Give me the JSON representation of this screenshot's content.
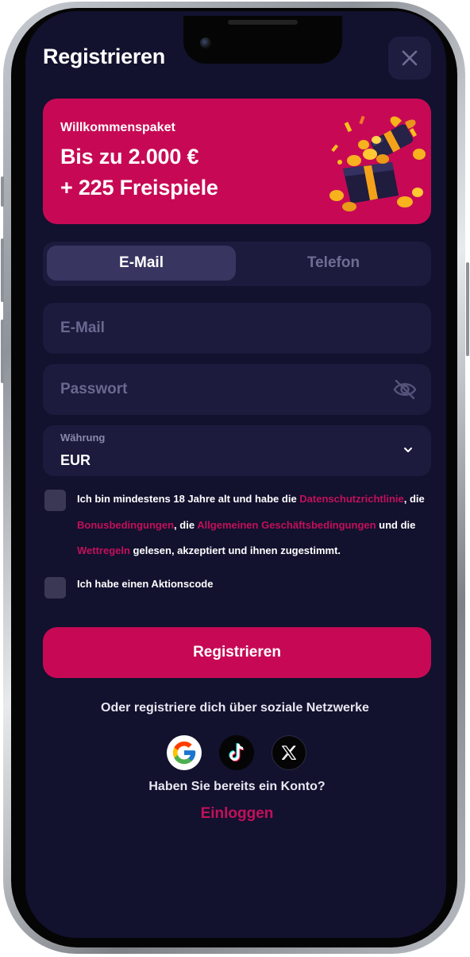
{
  "header": {
    "title": "Registrieren",
    "close_icon": "close-icon"
  },
  "banner": {
    "subtitle": "Willkommenspaket",
    "line1": "Bis zu 2.000 €",
    "line2": "+ 225 Freispiele",
    "image": "gift-box-with-coins"
  },
  "tabs": [
    {
      "label": "E-Mail",
      "active": true
    },
    {
      "label": "Telefon",
      "active": false
    }
  ],
  "form": {
    "email_placeholder": "E-Mail",
    "password_placeholder": "Passwort",
    "password_toggle_icon": "eye-off-icon",
    "currency_label": "Währung",
    "currency_value": "EUR",
    "currency_icon": "chevron-down-icon"
  },
  "consent": {
    "t1": "Ich bin mindestens 18 Jahre alt und habe die ",
    "link_privacy": "Datenschutzrichtlinie",
    "t2": ", die ",
    "link_bonus": "Bonusbedingungen",
    "t3": ", die ",
    "link_terms": "Allgemeinen Geschäftsbedingungen",
    "t4": " und die ",
    "link_betting": "Wettregeln",
    "t5": " gelesen, akzeptiert und ihnen zugestimmt."
  },
  "promo": {
    "label": "Ich habe einen Aktionscode"
  },
  "register_button": "Registrieren",
  "social": {
    "caption": "Oder registriere dich über soziale Netzwerke",
    "providers": [
      "google-icon",
      "tiktok-icon",
      "x-icon"
    ]
  },
  "login": {
    "question": "Haben Sie bereits ein Konto?",
    "link": "Einloggen"
  },
  "colors": {
    "background": "#12112e",
    "accent": "#c70955",
    "field": "#1c1b3d",
    "link": "#c2105a"
  }
}
